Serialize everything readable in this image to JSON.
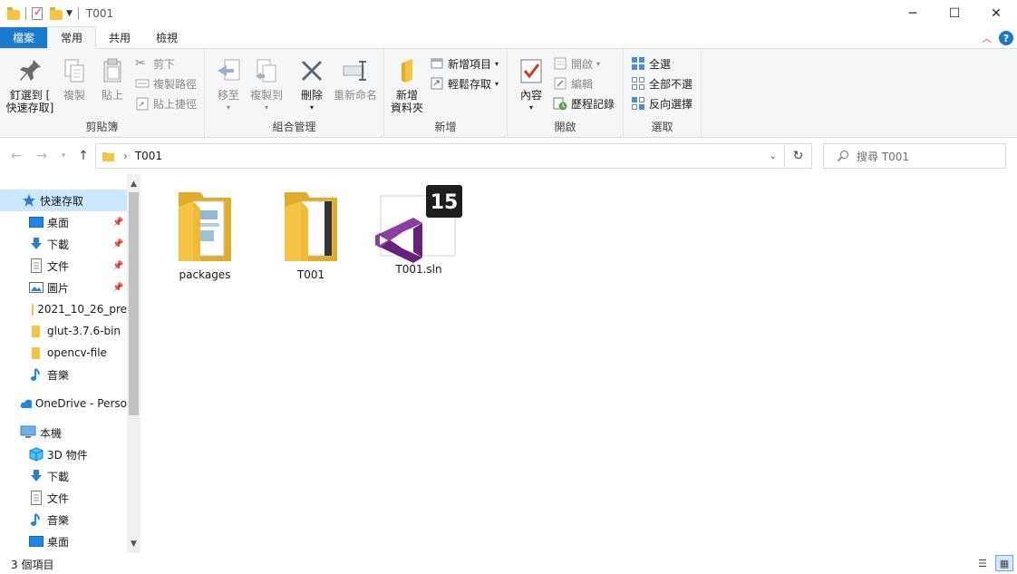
{
  "window": {
    "title": "T001",
    "controls": {
      "minimize": "─",
      "maximize": "☐",
      "close": "✕"
    }
  },
  "ribbon_tabs": [
    {
      "label": "檔案"
    },
    {
      "label": "常用"
    },
    {
      "label": "共用"
    },
    {
      "label": "檢視"
    }
  ],
  "ribbon": {
    "clipboard": {
      "group_label": "剪貼簿",
      "pin_label_1": "釘選到 [",
      "pin_label_2": "快速存取]",
      "copy": "複製",
      "paste": "貼上",
      "cut": "剪下",
      "copy_path": "複製路徑",
      "paste_shortcut": "貼上捷徑"
    },
    "organize": {
      "group_label": "組合管理",
      "move_to": "移至",
      "copy_to": "複製到",
      "delete": "刪除",
      "rename": "重新命名"
    },
    "new": {
      "group_label": "新增",
      "new_folder_1": "新增",
      "new_folder_2": "資料夾",
      "new_item": "新增項目",
      "easy_access": "輕鬆存取"
    },
    "open": {
      "group_label": "開啟",
      "properties": "內容",
      "open": "開啟",
      "edit": "編輯",
      "history": "歷程記錄"
    },
    "select": {
      "group_label": "選取",
      "select_all": "全選",
      "select_none": "全部不選",
      "invert": "反向選擇"
    }
  },
  "address": {
    "path": "T001",
    "separator": "›",
    "search_placeholder": "搜尋 T001"
  },
  "sidebar": {
    "quick_access": "快速存取",
    "items": [
      {
        "label": "桌面",
        "pinned": true
      },
      {
        "label": "下載",
        "pinned": true
      },
      {
        "label": "文件",
        "pinned": true
      },
      {
        "label": "圖片",
        "pinned": true
      },
      {
        "label": "2021_10_26_pre",
        "pinned": false
      },
      {
        "label": "glut-3.7.6-bin",
        "pinned": false
      },
      {
        "label": "opencv-file",
        "pinned": false
      },
      {
        "label": "音樂",
        "pinned": false
      }
    ],
    "onedrive": "OneDrive - Perso",
    "this_pc": "本機",
    "pc_items": [
      {
        "label": "3D 物件"
      },
      {
        "label": "下載"
      },
      {
        "label": "文件"
      },
      {
        "label": "音樂"
      },
      {
        "label": "桌面"
      }
    ]
  },
  "files": [
    {
      "name": "packages",
      "type": "folder"
    },
    {
      "name": "T001",
      "type": "folder"
    },
    {
      "name": "T001.sln",
      "type": "sln",
      "badge": "15"
    }
  ],
  "status": {
    "item_count": "3 個項目"
  },
  "colors": {
    "accent": "#1979ca",
    "selected_bg": "#cce8ff",
    "folder": "#f5c445",
    "vs_purple": "#68217a"
  }
}
